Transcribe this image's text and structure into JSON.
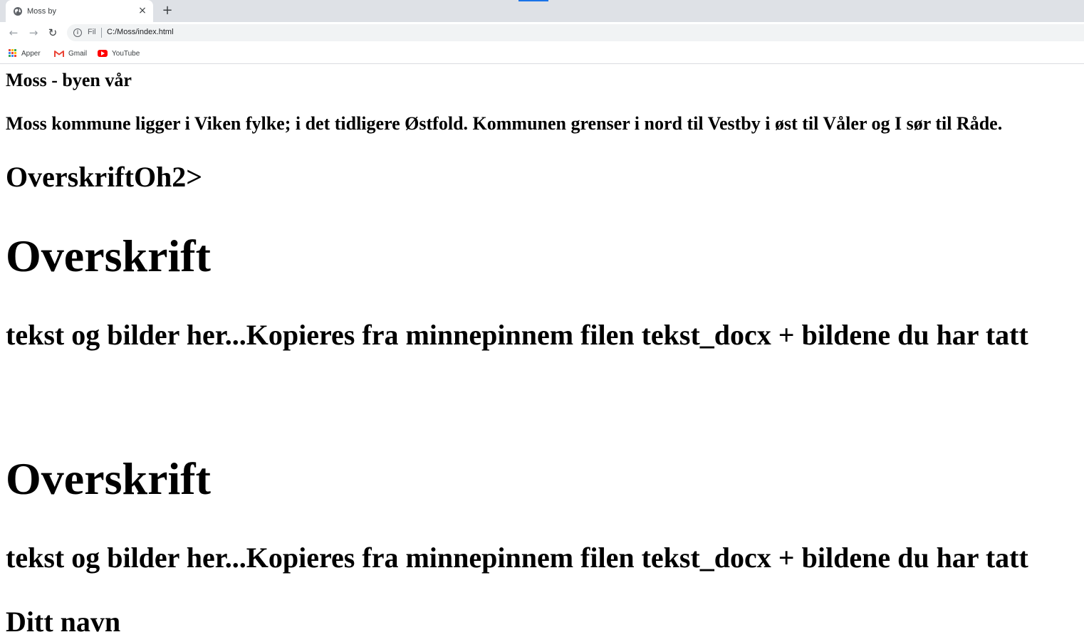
{
  "browser": {
    "tab_title": "Moss by",
    "tab_close": "×",
    "new_tab": "+",
    "nav_back": "←",
    "nav_forward": "→",
    "nav_reload": "↻",
    "address": {
      "info_icon": "i",
      "scheme": "Fil",
      "url": "C:/Moss/index.html"
    },
    "bookmarks": [
      {
        "label": "Apper",
        "icon": "apps-grid-icon"
      },
      {
        "label": "Gmail",
        "icon": "gmail-icon"
      },
      {
        "label": "YouTube",
        "icon": "youtube-icon"
      }
    ],
    "colors": {
      "tab_strip": "#dee1e6",
      "accent": "#1a73e8",
      "youtube": "#ff0000"
    }
  },
  "page": {
    "site_heading": "Moss - byen vår",
    "intro": "Moss kommune ligger i Viken fylke; i det tidligere Østfold. Kommunen grenser i nord til Vestby i øst til Våler og I sør til Råde.",
    "broken_heading": "OverskriftOh2>",
    "sections": [
      {
        "heading": "Overskrift",
        "text": "tekst og bilder her...Kopieres fra minnepinnem filen tekst_docx + bildene du har tatt"
      },
      {
        "heading": "Overskrift",
        "text": "tekst og bilder her...Kopieres fra minnepinnem filen tekst_docx + bildene du har tatt"
      }
    ],
    "footer_name": "Ditt navn"
  }
}
